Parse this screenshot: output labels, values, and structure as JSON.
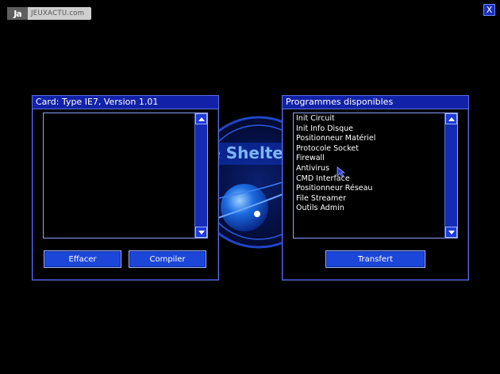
{
  "watermark": {
    "mark": "Ja",
    "text": "JEUXACTU.com"
  },
  "close_label": "X",
  "emblem_text": "he Shelte",
  "left_window": {
    "title": "Card: Type IE7, Version 1.01",
    "items": [],
    "buttons": {
      "clear": "Effacer",
      "compile": "Compiler"
    }
  },
  "right_window": {
    "title": "Programmes disponibles",
    "items": [
      "Init Circuit",
      "Init Info Disque",
      "Positionneur Matériel",
      "Protocole Socket",
      "Firewall",
      "Antivirus",
      "CMD Interface",
      "Positionneur Réseau",
      "File Streamer",
      "Outils Admin"
    ],
    "buttons": {
      "transfer": "Transfert"
    }
  },
  "colors": {
    "accent": "#1222a8",
    "button": "#1c46d8",
    "border": "#5a6fd8"
  }
}
